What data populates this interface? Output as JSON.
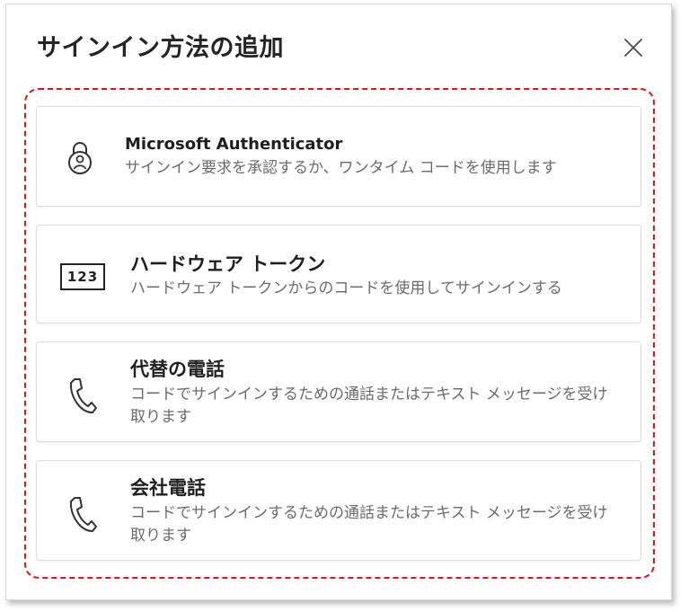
{
  "dialog": {
    "title": "サインイン方法の追加",
    "close_icon": "close-icon"
  },
  "options": [
    {
      "title": "Microsoft Authenticator",
      "description": "サインイン要求を承認するか、ワンタイム コードを使用します",
      "icon": "authenticator-lock-icon"
    },
    {
      "title": "ハードウェア トークン",
      "description": "ハードウェア トークンからのコードを使用してサインインする",
      "icon": "hardware-token-icon",
      "icon_text": "123"
    },
    {
      "title": "代替の電話",
      "description": "コードでサインインするための通話またはテキスト メッセージを受け取ります",
      "icon": "phone-icon"
    },
    {
      "title": "会社電話",
      "description": "コードでサインインするための通話またはテキスト メッセージを受け取ります",
      "icon": "phone-icon"
    }
  ],
  "colors": {
    "highlight_border": "#e0121b",
    "description_text": "#6b6b6b",
    "title_text": "#242424"
  }
}
